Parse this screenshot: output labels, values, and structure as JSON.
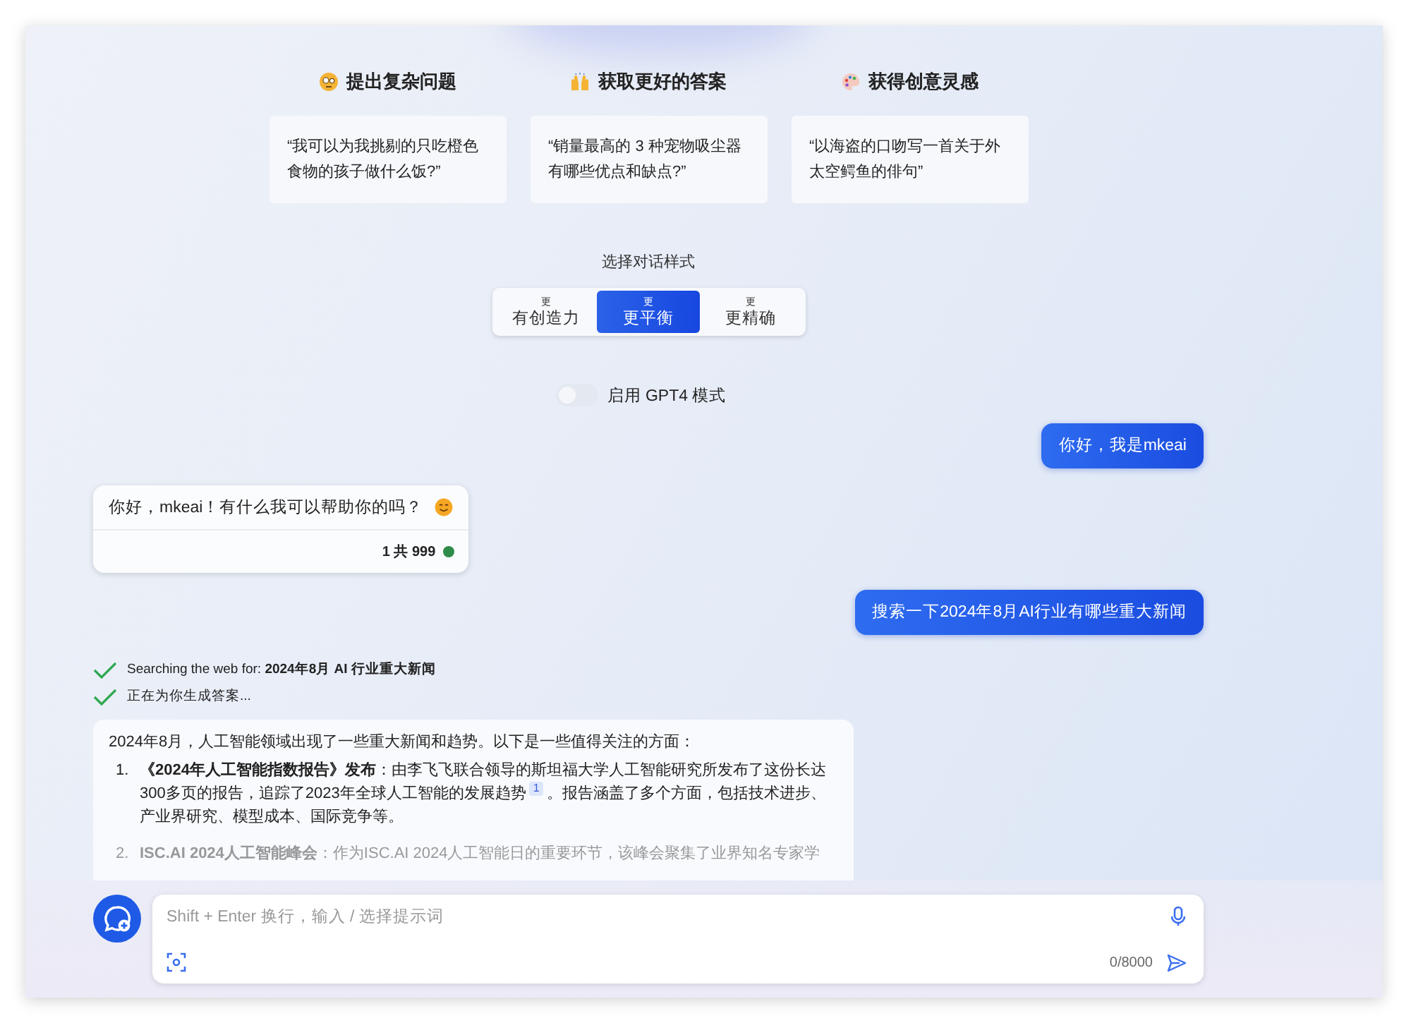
{
  "suggestions": [
    {
      "heading": "提出复杂问题",
      "prompt": "“我可以为我挑剔的只吃橙色食物的孩子做什么饭?”"
    },
    {
      "heading": "获取更好的答案",
      "prompt": "“销量最高的 3 种宠物吸尘器有哪些优点和缺点?”"
    },
    {
      "heading": "获得创意灵感",
      "prompt": "“以海盗的口吻写一首关于外太空鳄鱼的俳句”"
    }
  ],
  "style_picker": {
    "label": "选择对话样式",
    "options": [
      {
        "top": "更",
        "label": "有创造力",
        "selected": false
      },
      {
        "top": "更",
        "label": "更平衡",
        "selected": true
      },
      {
        "top": "更",
        "label": "更精确",
        "selected": false
      }
    ]
  },
  "gpt4_toggle": {
    "label": "启用 GPT4 模式",
    "on": false
  },
  "messages": [
    {
      "kind": "user",
      "text": "你好，我是mkeai"
    },
    {
      "kind": "bot",
      "text": "你好，mkeai！有什么我可以帮助你的吗？",
      "counter": "1 共 999"
    },
    {
      "kind": "user",
      "text": "搜索一下2024年8月AI行业有哪些重大新闻"
    },
    {
      "kind": "steps",
      "items": [
        {
          "text": "Searching the web for: **2024年8月 AI 行业重大新闻**",
          "done": true
        },
        {
          "text": "正在为你生成答案...",
          "done": true
        }
      ]
    },
    {
      "kind": "answer",
      "intro": "2024年8月，人工智能领域出现了一些重大新闻和趋势。以下是一些值得关注的方面：",
      "items": [
        {
          "number": "1.",
          "text": "**《2024年人工智能指数报告》发布**：由李飞飞联合领导的斯坦福大学人工智能研究所发布了这份长达300多页的报告，追踪了2023年全球人工智能的发展趋势",
          "ref": "1",
          "tail": "。报告涵盖了多个方面，包括技术进步、产业界研究、模型成本、国际竞争等。"
        },
        {
          "number": "2.",
          "text": "**ISC.AI 2024人工智能峰会**：作为ISC.AI 2024人工智能日的重要环节，该峰会聚集了业界知名专家学"
        }
      ]
    }
  ],
  "composer": {
    "placeholder": "Shift + Enter 换行，输入 / 选择提示词",
    "counter": "0/8000"
  }
}
